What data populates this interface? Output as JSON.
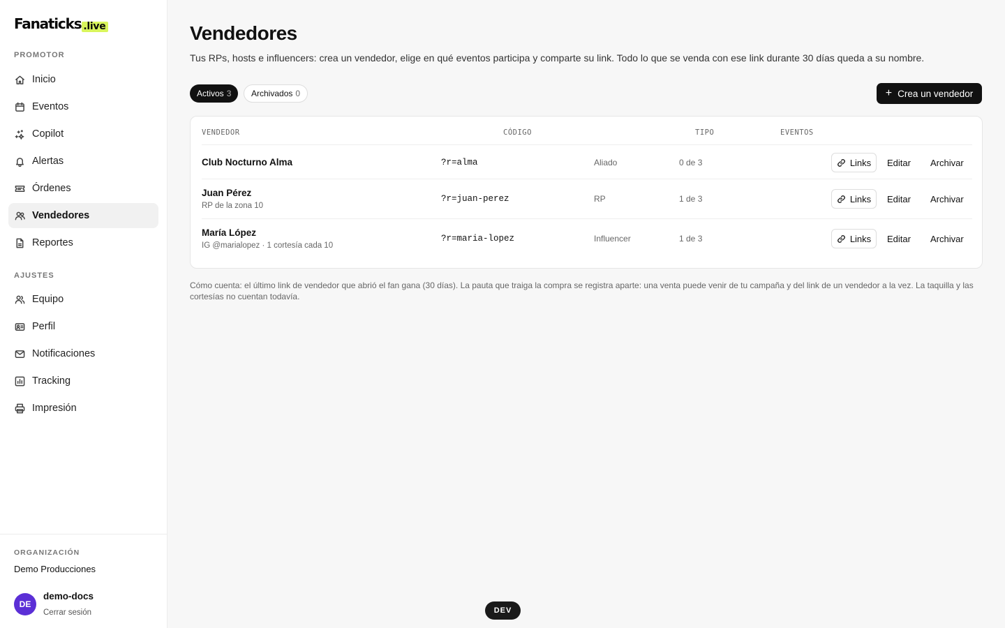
{
  "brand": {
    "logo_main": "Fanaticks",
    "logo_live": ".live",
    "accent": "#d9f55c"
  },
  "sidebar": {
    "section_promotor": "PROMOTOR",
    "promotor_items": [
      {
        "label": "Inicio",
        "icon": "home-icon"
      },
      {
        "label": "Eventos",
        "icon": "calendar-icon"
      },
      {
        "label": "Copilot",
        "icon": "sparkles-icon"
      },
      {
        "label": "Alertas",
        "icon": "bell-icon"
      },
      {
        "label": "Órdenes",
        "icon": "ticket-icon"
      },
      {
        "label": "Vendedores",
        "icon": "users-icon",
        "active": true
      },
      {
        "label": "Reportes",
        "icon": "report-icon"
      }
    ],
    "section_ajustes": "AJUSTES",
    "ajustes_items": [
      {
        "label": "Equipo",
        "icon": "team-icon"
      },
      {
        "label": "Perfil",
        "icon": "id-card-icon"
      },
      {
        "label": "Notificaciones",
        "icon": "mail-icon"
      },
      {
        "label": "Tracking",
        "icon": "chart-icon"
      },
      {
        "label": "Impresión",
        "icon": "printer-icon"
      }
    ],
    "org_label": "ORGANIZACIÓN",
    "org_name": "Demo Producciones",
    "user_initials": "DE",
    "user_name": "demo-docs",
    "logout": "Cerrar sesión"
  },
  "main": {
    "title": "Vendedores",
    "subtitle": "Tus RPs, hosts e influencers: crea un vendedor, elige en qué eventos participa y comparte su link. Todo lo que se venda con ese link durante 30 días queda a su nombre.",
    "tabs": [
      {
        "label": "Activos",
        "count": "3"
      },
      {
        "label": "Archivados",
        "count": "0"
      }
    ],
    "create_button": "Crea un vendedor",
    "table": {
      "headers": [
        "VENDEDOR",
        "CÓDIGO",
        "TIPO",
        "EVENTOS"
      ],
      "rows": [
        {
          "name": "Club Nocturno Alma",
          "sub": "",
          "code": "?r=alma",
          "type": "Aliado",
          "events": "0 de 3"
        },
        {
          "name": "Juan Pérez",
          "sub": "RP de la zona 10",
          "code": "?r=juan-perez",
          "type": "RP",
          "events": "1 de 3"
        },
        {
          "name": "María López",
          "sub": "IG @marialopez · 1 cortesía cada 10",
          "code": "?r=maria-lopez",
          "type": "Influencer",
          "events": "1 de 3"
        }
      ],
      "actions": {
        "links": "Links",
        "edit": "Editar",
        "archive": "Archivar"
      }
    },
    "footnote": "Cómo cuenta: el último link de vendedor que abrió el fan gana (30 días). La pauta que traiga la compra se registra aparte: una venta puede venir de tu campaña y del link de un vendedor a la vez. La taquilla y las cortesías no cuentan todavía."
  },
  "env_badge": "DEV"
}
